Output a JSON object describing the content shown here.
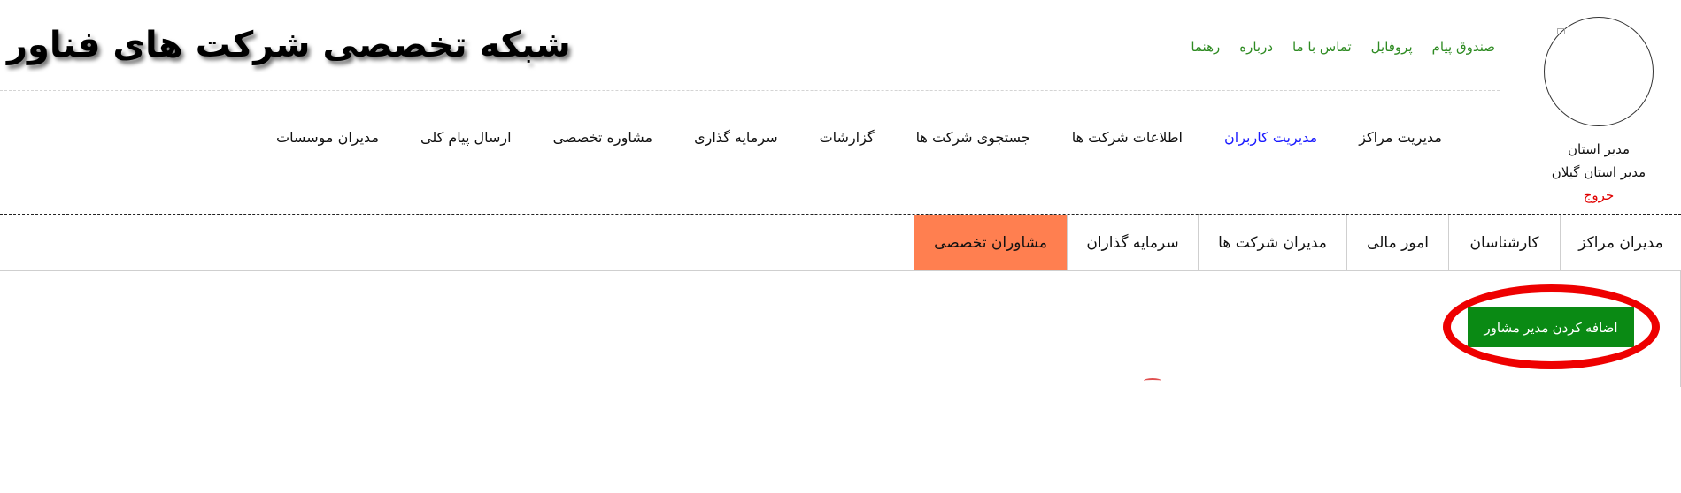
{
  "header": {
    "brand_title": "شبکه تخصصی شرکت های فناور",
    "top_links": [
      {
        "label": "صندوق پیام"
      },
      {
        "label": "پروفایل"
      },
      {
        "label": "تماس با ما"
      },
      {
        "label": "درباره"
      },
      {
        "label": "رهنما"
      }
    ]
  },
  "user": {
    "role": "مدیر استان",
    "title": "مدیر استان گیلان",
    "logout_label": "خروج"
  },
  "main_nav": {
    "items": [
      {
        "label": "مدیریت مراکز"
      },
      {
        "label": "مدیریت کاربران"
      },
      {
        "label": "اطلاعات شرکت ها"
      },
      {
        "label": "جستجوی شرکت ها"
      },
      {
        "label": "گزارشات"
      },
      {
        "label": "سرمایه گذاری"
      },
      {
        "label": "مشاوره تخصصی"
      },
      {
        "label": "ارسال پیام کلی"
      },
      {
        "label": "مدیران موسسات"
      }
    ],
    "active_index": 1
  },
  "tabs": {
    "items": [
      {
        "label": "مدیران مراکز"
      },
      {
        "label": "کارشناسان"
      },
      {
        "label": "امور مالی"
      },
      {
        "label": "مدیران شرکت ها"
      },
      {
        "label": "سرمایه گذاران"
      },
      {
        "label": "مشاوران تخصصی"
      }
    ],
    "active_index": 5,
    "active_color": "#ff7f50"
  },
  "content": {
    "add_button_label": "اضافه کردن مدیر مشاور",
    "add_button_color": "#0a8a14",
    "highlight_color": "#ee0000"
  }
}
